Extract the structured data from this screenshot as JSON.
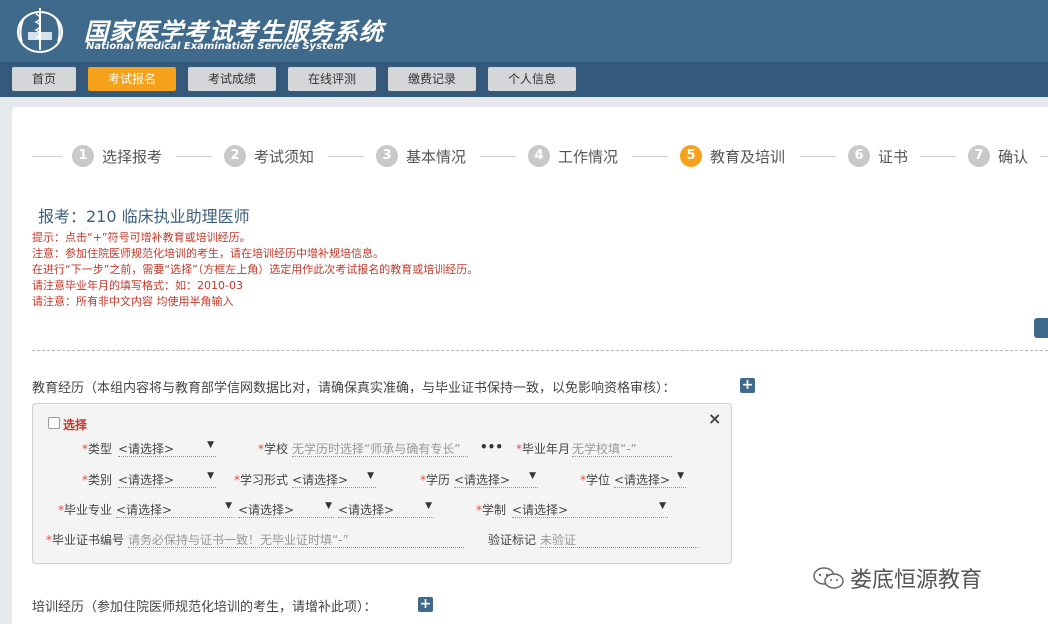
{
  "header": {
    "title_cn": "国家医学考试考生服务系统",
    "title_en": "National Medical Examination Service System",
    "bg_color": "#3f6a8c"
  },
  "nav": {
    "items": [
      {
        "label": "首页",
        "active": false
      },
      {
        "label": "考试报名",
        "active": true
      },
      {
        "label": "考试成绩",
        "active": false
      },
      {
        "label": "在线评测",
        "active": false
      },
      {
        "label": "缴费记录",
        "active": false
      },
      {
        "label": "个人信息",
        "active": false
      }
    ],
    "active_color": "#f5a11a"
  },
  "steps": [
    {
      "num": "1",
      "label": "选择报考",
      "active": false
    },
    {
      "num": "2",
      "label": "考试须知",
      "active": false
    },
    {
      "num": "3",
      "label": "基本情况",
      "active": false
    },
    {
      "num": "4",
      "label": "工作情况",
      "active": false
    },
    {
      "num": "5",
      "label": "教育及培训",
      "active": true
    },
    {
      "num": "6",
      "label": "证书",
      "active": false
    },
    {
      "num": "7",
      "label": "确认",
      "active": false
    }
  ],
  "exam_title": "报考：210 临床执业助理医师",
  "notes": [
    "提示：点击“+”符号可增补教育或培训经历。",
    "注意：参加住院医师规范化培训的考生，请在培训经历中增补规培信息。",
    "在进行“下一步”之前，需要“选择”（方框左上角）选定用作此次考试报名的教育或培训经历。",
    "请注意毕业年月的填写格式：如：2010-03",
    "请注意：所有非中文内容 均使用半角输入"
  ],
  "education": {
    "section_label": "教育经历（本组内容将与教育部学信网数据比对，请确保真实准确，与毕业证书保持一致，以免影响资格审核）：",
    "select_label": "选择",
    "close": "×",
    "fields": {
      "type_label": "类型",
      "type_value": "<请选择>",
      "school_label": "学校",
      "school_placeholder": "无学历时选择“师承与确有专长”",
      "school_more": "•••",
      "grad_label": "毕业年月",
      "grad_placeholder": "无学校填“-”",
      "category_label": "类别",
      "category_value": "<请选择>",
      "form_label": "学习形式",
      "form_value": "<请选择>",
      "degree_label": "学历",
      "degree_value": "<请选择>",
      "xuewei_label": "学位",
      "xuewei_value": "<请选择>",
      "major_label": "毕业专业",
      "major_value1": "<请选择>",
      "major_value2": "<请选择>",
      "major_value3": "<请选择>",
      "system_label": "学制",
      "system_value": "<请选择>",
      "cert_label": "毕业证书编号",
      "cert_placeholder": "请务必保持与证书一致！无毕业证时填“-”",
      "verify_label": "验证标记",
      "verify_value": "未验证"
    }
  },
  "training": {
    "section_label": "培训经历（参加住院医师规范化培训的考生，请增补此项）："
  },
  "watermark": "娄底恒源教育"
}
